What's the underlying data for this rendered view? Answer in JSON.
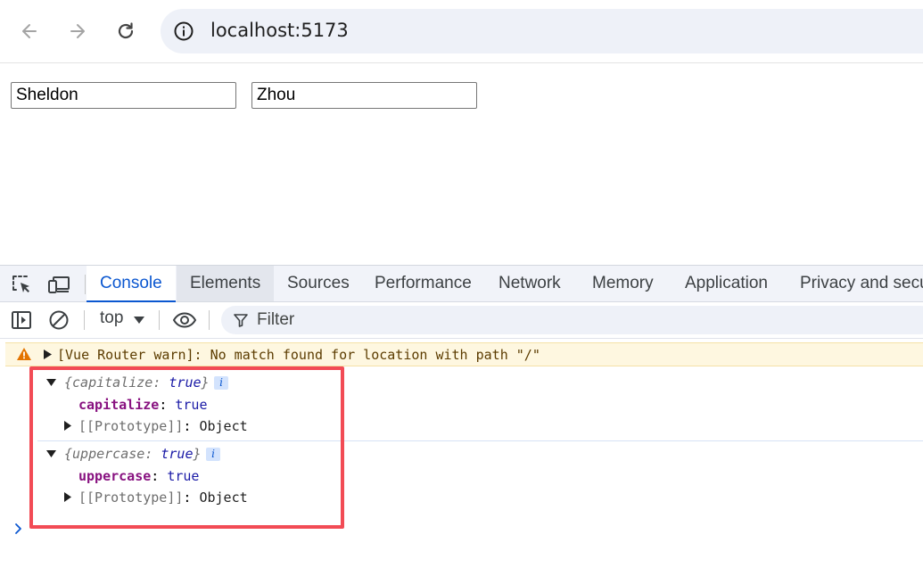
{
  "browser": {
    "url": "localhost:5173",
    "icons": {
      "back": "arrow-left-icon",
      "forward": "arrow-right-icon",
      "reload": "reload-icon",
      "site_info": "info-circle-icon"
    }
  },
  "page": {
    "first_name": "Sheldon",
    "last_name": "Zhou"
  },
  "devtools": {
    "tabs": [
      "Console",
      "Elements",
      "Sources",
      "Performance",
      "Network",
      "Memory",
      "Application",
      "Privacy and secu"
    ],
    "active_tab": "Console",
    "hovered_tab": "Elements",
    "filterbar": {
      "context": "top",
      "filter_placeholder": "Filter"
    },
    "console": {
      "warning": "[Vue Router warn]: No match found for location with path \"/\"",
      "objects": [
        {
          "preview_key": "capitalize",
          "preview_val": "true",
          "prop_key": "capitalize",
          "prop_val": "true",
          "proto_key": "[[Prototype]]",
          "proto_val": "Object"
        },
        {
          "preview_key": "uppercase",
          "preview_val": "true",
          "prop_key": "uppercase",
          "prop_val": "true",
          "proto_key": "[[Prototype]]",
          "proto_val": "Object"
        }
      ],
      "info_badge": "i"
    },
    "colors": {
      "accent": "#0b57d0",
      "highlight_border": "#f24b55",
      "warning_bg": "#fef7e0",
      "prop_key": "#881280",
      "prop_val": "#1a1aa6"
    }
  }
}
